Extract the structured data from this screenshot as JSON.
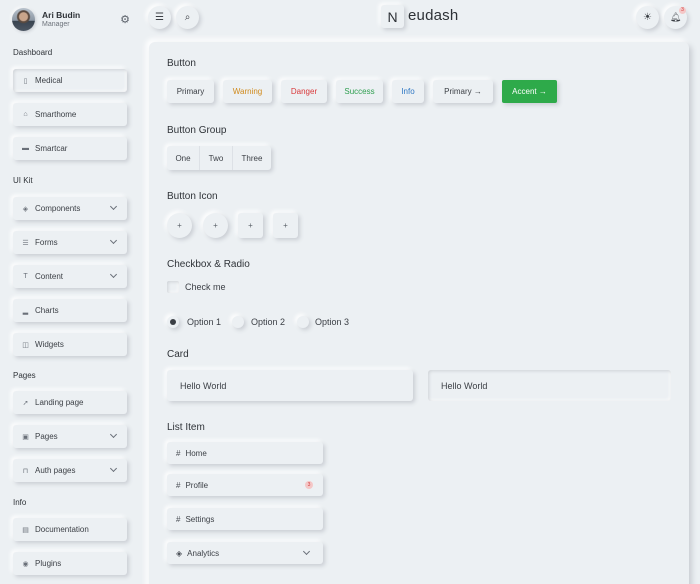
{
  "user": {
    "name": "Ari Budin",
    "role": "Manager"
  },
  "brand": {
    "letter": "N",
    "name": "eudash"
  },
  "notifications": {
    "count": "3"
  },
  "sidebar": {
    "sections": [
      {
        "title": "Dashboard"
      },
      {
        "title": "UI Kit"
      },
      {
        "title": "Pages"
      },
      {
        "title": "Info"
      }
    ],
    "items": [
      {
        "label": "Medical",
        "icon": "clipboard-icon"
      },
      {
        "label": "Smarthome",
        "icon": "home-icon"
      },
      {
        "label": "Smartcar",
        "icon": "car-icon"
      },
      {
        "label": "Components",
        "icon": "layers-icon"
      },
      {
        "label": "Forms",
        "icon": "list-icon"
      },
      {
        "label": "Content",
        "icon": "text-icon"
      },
      {
        "label": "Charts",
        "icon": "bar-chart-icon"
      },
      {
        "label": "Widgets",
        "icon": "widgets-icon"
      },
      {
        "label": "Landing page",
        "icon": "rocket-icon"
      },
      {
        "label": "Pages",
        "icon": "page-icon"
      },
      {
        "label": "Auth pages",
        "icon": "lock-icon"
      },
      {
        "label": "Documentation",
        "icon": "document-icon"
      },
      {
        "label": "Plugins",
        "icon": "plugin-icon"
      }
    ]
  },
  "sections": {
    "button": "Button",
    "button_group": "Button Group",
    "button_icon": "Button Icon",
    "checkbox_radio": "Checkbox & Radio",
    "card": "Card",
    "list_item": "List Item"
  },
  "buttons": [
    {
      "label": "Primary",
      "color": "#3b3f45"
    },
    {
      "label": "Warning",
      "color": "#d08a1c"
    },
    {
      "label": "Danger",
      "color": "#d9383a"
    },
    {
      "label": "Success",
      "color": "#2e9e4f"
    },
    {
      "label": "Info",
      "color": "#2f78c4"
    },
    {
      "label": "Primary →",
      "color": "#3b3f45"
    },
    {
      "label": "Accent →",
      "color": "#ffffff",
      "background": "#2eaa4a"
    }
  ],
  "button_group": [
    "One",
    "Two",
    "Three"
  ],
  "button_icons": [
    "+",
    "+",
    "+",
    "+"
  ],
  "checkbox": {
    "label": "Check me",
    "checked": false
  },
  "radios": [
    {
      "label": "Option 1",
      "selected": true
    },
    {
      "label": "Option 2",
      "selected": false
    },
    {
      "label": "Option 3",
      "selected": false
    }
  ],
  "cards": [
    "Hello World",
    "Hello World"
  ],
  "list_items": [
    {
      "label": "Home"
    },
    {
      "label": "Profile",
      "badge": "3"
    },
    {
      "label": "Settings"
    },
    {
      "label": "Analytics"
    }
  ]
}
